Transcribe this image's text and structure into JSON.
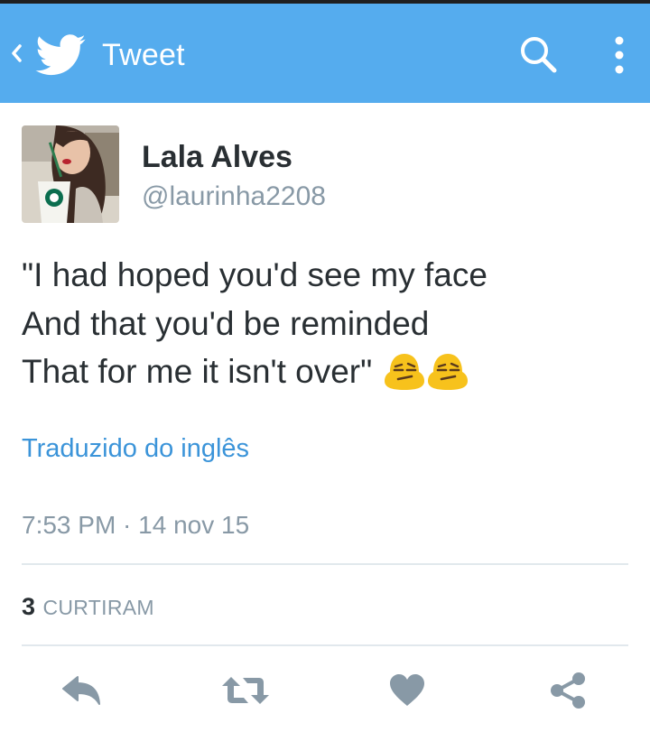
{
  "header": {
    "back_icon": "chevron-left-icon",
    "logo_icon": "twitter-bird-icon",
    "title": "Tweet",
    "search_icon": "search-icon",
    "menu_icon": "more-vertical-icon",
    "background_color": "#55acee"
  },
  "tweet": {
    "author_name": "Lala Alves",
    "author_handle": "@laurinha2208",
    "text_lines": [
      "\"I had hoped you'd see my face",
      "And that you'd be reminded",
      "That for me it isn't over\""
    ],
    "emojis": [
      "confused-face-emoji",
      "confused-face-emoji"
    ],
    "translation_link": "Traduzido do inglês",
    "timestamp": "7:53 PM · 14 nov 15",
    "likes_count": "3",
    "likes_label": "CURTIRAM"
  },
  "actions": [
    {
      "icon": "reply-icon"
    },
    {
      "icon": "retweet-icon"
    },
    {
      "icon": "heart-icon"
    },
    {
      "icon": "share-icon"
    }
  ],
  "colors": {
    "accent": "#55acee",
    "link": "#3b94d9",
    "text": "#292f33",
    "secondary_text": "#8899a6",
    "action_icon": "#8899a6",
    "divider": "#e1e8ed"
  }
}
